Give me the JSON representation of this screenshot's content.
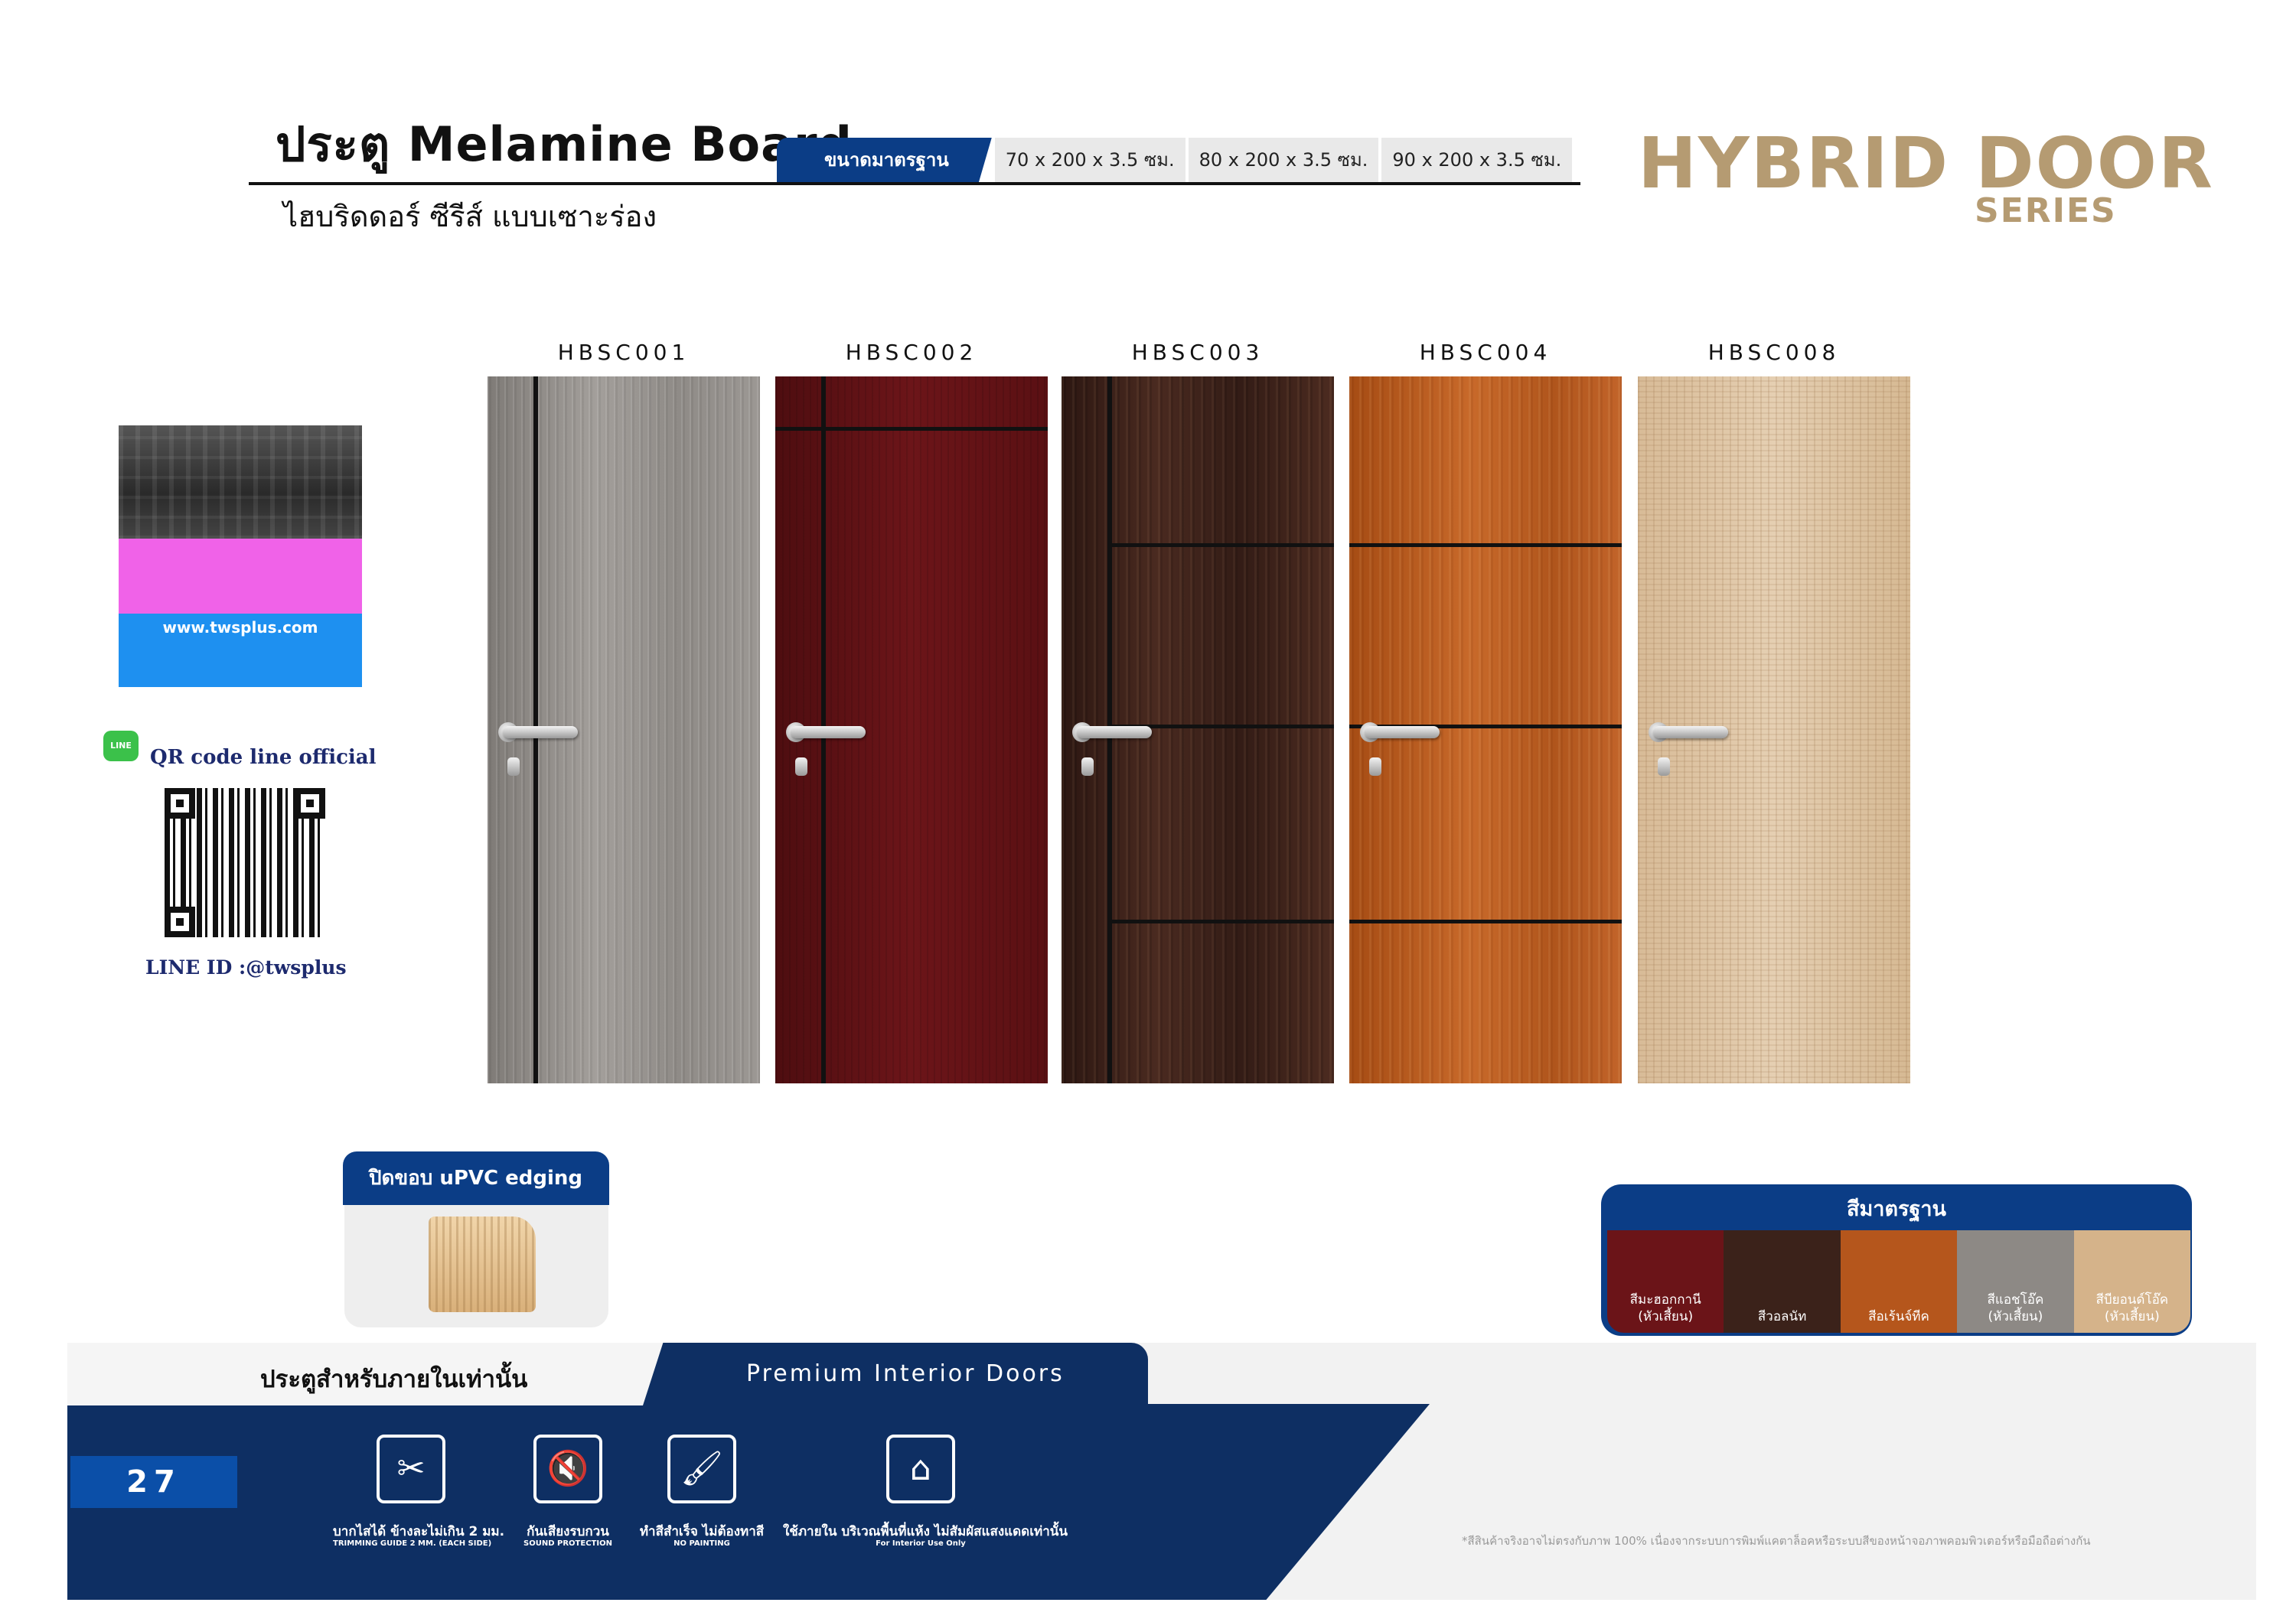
{
  "header": {
    "title": "ประตู Melamine Board",
    "subtitle": "ไฮบริดดอร์ ซีรีส์ แบบเซาะร่อง",
    "size_label": "ขนาดมาตรฐาน",
    "sizes": [
      "70 x 200 x 3.5 ซม.",
      "80 x 200 x 3.5 ซม.",
      "90 x 200 x 3.5 ซม."
    ],
    "brand_line1": "HYBRID DOOR",
    "brand_line2": "SERIES"
  },
  "sidebar": {
    "card_url": "www.twsplus.com",
    "qr_title": "QR code line official",
    "line_badge": "LINE",
    "line_id": "LINE ID :@twsplus"
  },
  "doors": [
    {
      "code": "HBSC001",
      "color": "#8c8884"
    },
    {
      "code": "HBSC002",
      "color": "#5e1114"
    },
    {
      "code": "HBSC003",
      "color": "#3a2019"
    },
    {
      "code": "HBSC004",
      "color": "#b5581c"
    },
    {
      "code": "HBSC008",
      "color": "#dcc1a0"
    }
  ],
  "edging": {
    "label": "ปิดขอบ uPVC edging"
  },
  "standard_colors": {
    "title": "สีมาตรฐาน",
    "items": [
      {
        "line1": "สีมะฮอกกานี",
        "line2": "(หัวเสี้ยน)",
        "color": "#6b1418"
      },
      {
        "line1": "สีวอลนัท",
        "line2": "",
        "color": "#3b221a"
      },
      {
        "line1": "สีอเร้นจ์ทีค",
        "line2": "",
        "color": "#b5561c"
      },
      {
        "line1": "สีแอชโอ๊ค",
        "line2": "(หัวเสี้ยน)",
        "color": "#8d8985"
      },
      {
        "line1": "สีบียอนด์โอ๊ค",
        "line2": "(หัวเสี้ยน)",
        "color": "#d5b38a"
      }
    ]
  },
  "footer": {
    "left_tab": "ประตูสำหรับภายในเท่านั้น",
    "right_tab": "Premium Interior Doors",
    "page_number": "27",
    "features": [
      {
        "title": "บากไสได้ ข้างละไม่เกิน 2 มม.",
        "sub": "TRIMMING GUIDE 2 MM. (EACH SIDE)",
        "icon": "trimming-icon",
        "glyph": "✂"
      },
      {
        "title": "กันเสียงรบกวน",
        "sub": "SOUND PROTECTION",
        "icon": "sound-protection-icon",
        "glyph": "🔇"
      },
      {
        "title": "ทำสีสำเร็จ ไม่ต้องทาสี",
        "sub": "NO PAINTING",
        "icon": "no-painting-icon",
        "glyph": "🖌"
      },
      {
        "title": "ใช้ภายใน บริเวณพื้นที่แห้ง ไม่สัมผัสแสงแดดเท่านั้น",
        "sub": "For Interior Use Only",
        "icon": "interior-use-icon",
        "glyph": "⌂"
      }
    ],
    "disclaimer": "*สีสินค้าจริงอาจไม่ตรงกับภาพ 100% เนื่องจากระบบการพิมพ์แคตาล็อคหรือระบบสีของหน้าจอภาพคอมพิวเตอร์หรือมือถือต่างกัน"
  }
}
